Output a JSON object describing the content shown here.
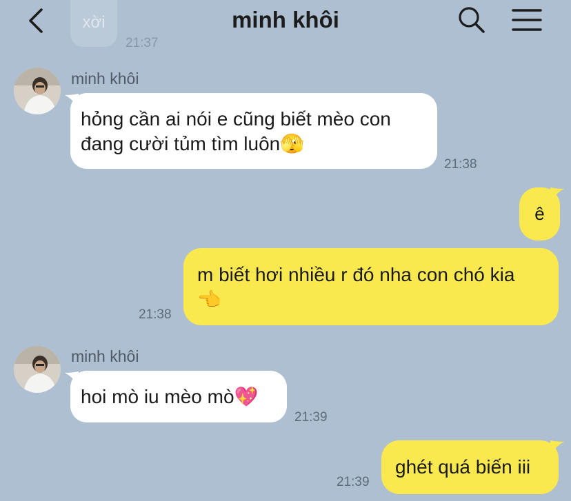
{
  "header": {
    "title": "minh khôi"
  },
  "previous": {
    "text": "xời",
    "time": "21:37"
  },
  "messages": [
    {
      "direction": "incoming",
      "sender": "minh khôi",
      "line1": "hỏng cần ai nói e cũng biết mèo con",
      "line2": "đang cười tủm tìm luôn",
      "emoji": "🫣",
      "time": "21:38"
    },
    {
      "direction": "outgoing",
      "text": "ê"
    },
    {
      "direction": "outgoing",
      "line1": "m biết hơi nhiều r đó nha con chó kia",
      "emoji": "👈",
      "time": "21:38"
    },
    {
      "direction": "incoming",
      "sender": "minh khôi",
      "text": "hoi mò iu mèo mò",
      "emoji": "💖",
      "time": "21:39"
    },
    {
      "direction": "outgoing",
      "text": "ghét quá biến iii",
      "time": "21:39"
    }
  ],
  "colors": {
    "background": "#adbfd1",
    "incoming_bubble": "#ffffff",
    "outgoing_bubble": "#fae84f"
  },
  "icons": [
    "back-icon",
    "search-icon",
    "menu-icon",
    "avatar-image"
  ]
}
